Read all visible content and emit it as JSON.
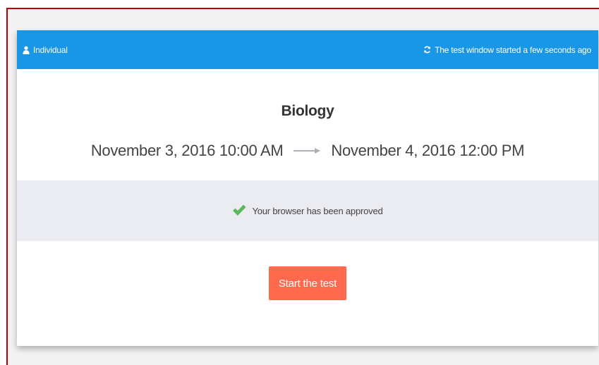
{
  "header": {
    "left_label": "Individual",
    "right_label": "The test window started a few seconds ago",
    "background_color": "#1a96e6",
    "left_icon": "user-icon",
    "right_icon": "refresh-icon"
  },
  "test": {
    "subject": "Biology",
    "start": "November 3, 2016 10:00 AM",
    "end": "November 4, 2016 12:00 PM",
    "arrow_icon": "arrow-right-icon"
  },
  "browser_check": {
    "icon": "checkmark-icon",
    "message": "Your browser has been approved",
    "status_color": "#5cb85c"
  },
  "actions": {
    "start_label": "Start the test",
    "button_color": "#ff6a4f"
  }
}
